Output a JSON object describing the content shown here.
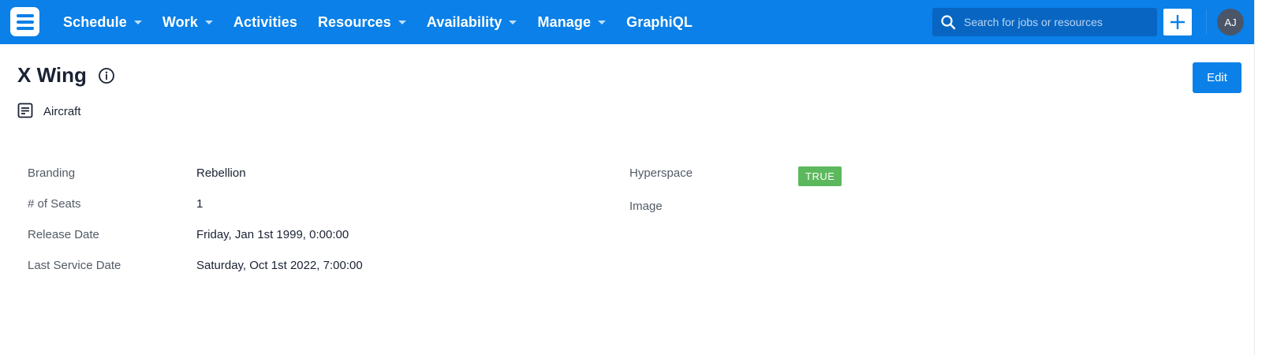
{
  "nav": {
    "items": [
      {
        "label": "Schedule",
        "has_menu": true
      },
      {
        "label": "Work",
        "has_menu": true
      },
      {
        "label": "Activities",
        "has_menu": false
      },
      {
        "label": "Resources",
        "has_menu": true
      },
      {
        "label": "Availability",
        "has_menu": true
      },
      {
        "label": "Manage",
        "has_menu": true
      },
      {
        "label": "GraphiQL",
        "has_menu": false
      }
    ],
    "search_placeholder": "Search for jobs or resources",
    "avatar_initials": "AJ",
    "colors": {
      "bar": "#0a80e8",
      "search_bg": "#0866c2",
      "avatar_bg": "#4a5568"
    }
  },
  "header": {
    "title": "X Wing",
    "type_label": "Aircraft",
    "edit_label": "Edit"
  },
  "fields": {
    "left": [
      {
        "label": "Branding",
        "value": "Rebellion"
      },
      {
        "label": "# of Seats",
        "value": "1"
      },
      {
        "label": "Release Date",
        "value": "Friday, Jan 1st 1999, 0:00:00"
      },
      {
        "label": "Last Service Date",
        "value": "Saturday, Oct 1st 2022, 7:00:00"
      }
    ],
    "right": [
      {
        "label": "Hyperspace",
        "badge": "TRUE",
        "badge_color": "#5cb85c"
      },
      {
        "label": "Image"
      }
    ]
  }
}
